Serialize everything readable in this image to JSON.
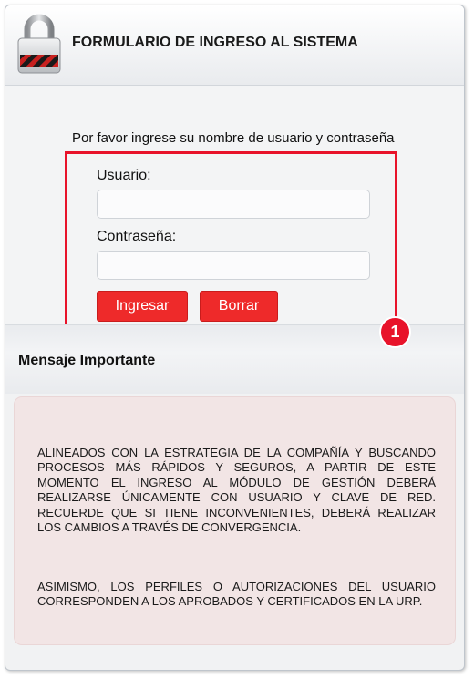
{
  "header": {
    "title": "FORMULARIO DE INGRESO AL SISTEMA"
  },
  "login": {
    "prompt": "Por favor ingrese su nombre de usuario y contraseña",
    "username_label": "Usuario:",
    "username_value": "",
    "password_label": "Contraseña:",
    "password_value": "",
    "submit_label": "Ingresar",
    "clear_label": "Borrar",
    "callout_number": "1"
  },
  "message": {
    "title": "Mensaje Importante",
    "paragraph1": "ALINEADOS CON LA ESTRATEGIA DE LA COMPAÑÍA Y BUSCANDO PROCESOS MÁS RÁPIDOS Y SEGUROS, A PARTIR DE ESTE MOMENTO EL INGRESO AL MÓDULO DE GESTIÓN DEBERÁ REALIZARSE ÚNICAMENTE CON USUARIO Y CLAVE DE RED. RECUERDE QUE SI TIENE INCONVENIENTES, DEBERÁ REALIZAR LOS CAMBIOS A TRAVÉS DE CONVERGENCIA.",
    "paragraph2": "ASIMISMO, LOS PERFILES O AUTORIZACIONES DEL USUARIO CORRESPONDEN A LOS APROBADOS Y CERTIFICADOS EN LA URP."
  },
  "icons": {
    "header_icon": "padlock-icon"
  },
  "colors": {
    "accent_red": "#ee2a2a",
    "highlight_red": "#e8132a",
    "notice_bg": "#f2e5e5"
  }
}
